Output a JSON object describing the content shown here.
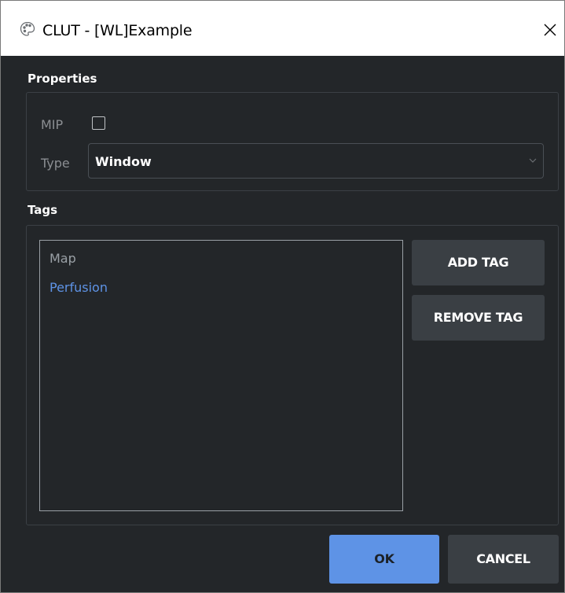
{
  "window": {
    "title": "CLUT -  [WL]Example",
    "icon": "palette-icon",
    "close_icon": "close-icon"
  },
  "properties": {
    "heading": "Properties",
    "mip_label": "MIP",
    "mip_checked": false,
    "type_label": "Type",
    "type_value": "Window"
  },
  "tags": {
    "heading": "Tags",
    "items": [
      {
        "label": "Map",
        "color": "#9aa0a6"
      },
      {
        "label": "Perfusion",
        "color": "#5e93e6"
      }
    ],
    "add_label": "ADD TAG",
    "remove_label": "REMOVE TAG"
  },
  "footer": {
    "ok_label": "OK",
    "cancel_label": "CANCEL"
  },
  "colors": {
    "background": "#232629",
    "accent": "#5e93e6",
    "button": "#3a3f44"
  }
}
